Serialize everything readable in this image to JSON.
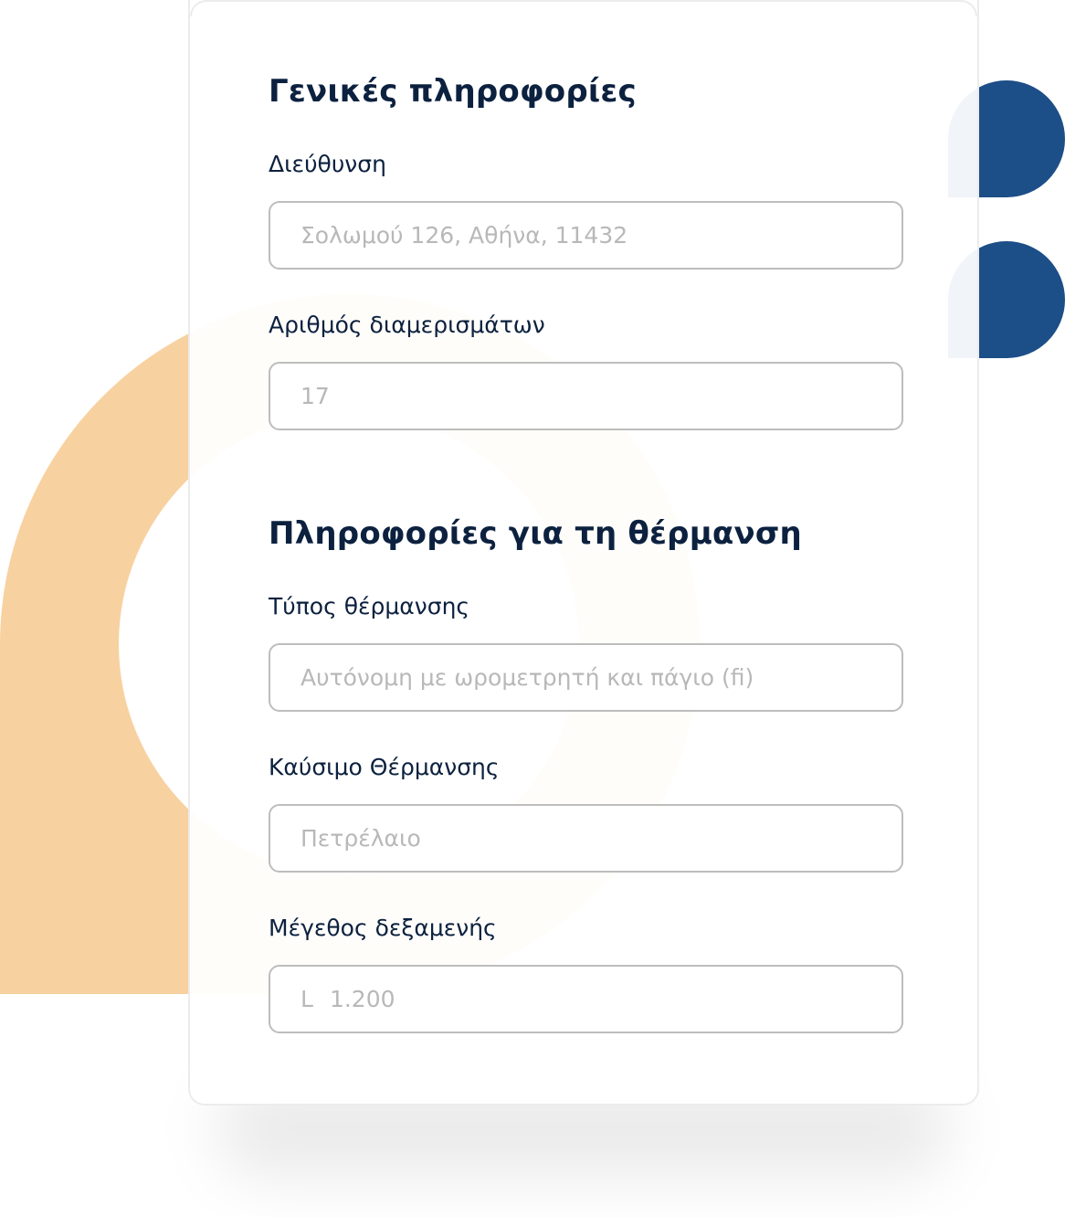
{
  "colors": {
    "accent_orange": "#f8d1a0",
    "accent_blue": "#1c4e87",
    "heading": "#0c213f",
    "placeholder": "#b8b8b8",
    "input_border": "#bdbdbd"
  },
  "general": {
    "title": "Γενικές πληροφορίες",
    "address": {
      "label": "Διεύθυνση",
      "value": "Σολωμού 126, Αθήνα, 11432"
    },
    "apartments": {
      "label": "Αριθμός διαμερισμάτων",
      "value": "17"
    }
  },
  "heating": {
    "title": "Πληροφορίες για τη θέρμανση",
    "type": {
      "label": "Τύπος θέρμανσης",
      "value": "Αυτόνομη με ωρομετρητή και πάγιο (fi)"
    },
    "fuel": {
      "label": "Καύσιμο Θέρμανσης",
      "value": "Πετρέλαιο"
    },
    "tank": {
      "label": "Μέγεθος δεξαμενής",
      "unit": "L",
      "value": "1.200"
    }
  }
}
